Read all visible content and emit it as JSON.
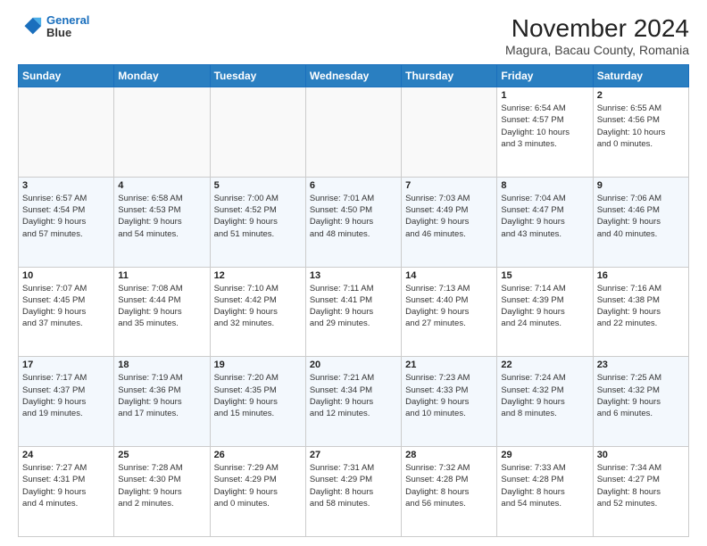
{
  "logo": {
    "line1": "General",
    "line2": "Blue"
  },
  "title": "November 2024",
  "location": "Magura, Bacau County, Romania",
  "days_of_week": [
    "Sunday",
    "Monday",
    "Tuesday",
    "Wednesday",
    "Thursday",
    "Friday",
    "Saturday"
  ],
  "weeks": [
    [
      {
        "day": "",
        "info": ""
      },
      {
        "day": "",
        "info": ""
      },
      {
        "day": "",
        "info": ""
      },
      {
        "day": "",
        "info": ""
      },
      {
        "day": "",
        "info": ""
      },
      {
        "day": "1",
        "info": "Sunrise: 6:54 AM\nSunset: 4:57 PM\nDaylight: 10 hours\nand 3 minutes."
      },
      {
        "day": "2",
        "info": "Sunrise: 6:55 AM\nSunset: 4:56 PM\nDaylight: 10 hours\nand 0 minutes."
      }
    ],
    [
      {
        "day": "3",
        "info": "Sunrise: 6:57 AM\nSunset: 4:54 PM\nDaylight: 9 hours\nand 57 minutes."
      },
      {
        "day": "4",
        "info": "Sunrise: 6:58 AM\nSunset: 4:53 PM\nDaylight: 9 hours\nand 54 minutes."
      },
      {
        "day": "5",
        "info": "Sunrise: 7:00 AM\nSunset: 4:52 PM\nDaylight: 9 hours\nand 51 minutes."
      },
      {
        "day": "6",
        "info": "Sunrise: 7:01 AM\nSunset: 4:50 PM\nDaylight: 9 hours\nand 48 minutes."
      },
      {
        "day": "7",
        "info": "Sunrise: 7:03 AM\nSunset: 4:49 PM\nDaylight: 9 hours\nand 46 minutes."
      },
      {
        "day": "8",
        "info": "Sunrise: 7:04 AM\nSunset: 4:47 PM\nDaylight: 9 hours\nand 43 minutes."
      },
      {
        "day": "9",
        "info": "Sunrise: 7:06 AM\nSunset: 4:46 PM\nDaylight: 9 hours\nand 40 minutes."
      }
    ],
    [
      {
        "day": "10",
        "info": "Sunrise: 7:07 AM\nSunset: 4:45 PM\nDaylight: 9 hours\nand 37 minutes."
      },
      {
        "day": "11",
        "info": "Sunrise: 7:08 AM\nSunset: 4:44 PM\nDaylight: 9 hours\nand 35 minutes."
      },
      {
        "day": "12",
        "info": "Sunrise: 7:10 AM\nSunset: 4:42 PM\nDaylight: 9 hours\nand 32 minutes."
      },
      {
        "day": "13",
        "info": "Sunrise: 7:11 AM\nSunset: 4:41 PM\nDaylight: 9 hours\nand 29 minutes."
      },
      {
        "day": "14",
        "info": "Sunrise: 7:13 AM\nSunset: 4:40 PM\nDaylight: 9 hours\nand 27 minutes."
      },
      {
        "day": "15",
        "info": "Sunrise: 7:14 AM\nSunset: 4:39 PM\nDaylight: 9 hours\nand 24 minutes."
      },
      {
        "day": "16",
        "info": "Sunrise: 7:16 AM\nSunset: 4:38 PM\nDaylight: 9 hours\nand 22 minutes."
      }
    ],
    [
      {
        "day": "17",
        "info": "Sunrise: 7:17 AM\nSunset: 4:37 PM\nDaylight: 9 hours\nand 19 minutes."
      },
      {
        "day": "18",
        "info": "Sunrise: 7:19 AM\nSunset: 4:36 PM\nDaylight: 9 hours\nand 17 minutes."
      },
      {
        "day": "19",
        "info": "Sunrise: 7:20 AM\nSunset: 4:35 PM\nDaylight: 9 hours\nand 15 minutes."
      },
      {
        "day": "20",
        "info": "Sunrise: 7:21 AM\nSunset: 4:34 PM\nDaylight: 9 hours\nand 12 minutes."
      },
      {
        "day": "21",
        "info": "Sunrise: 7:23 AM\nSunset: 4:33 PM\nDaylight: 9 hours\nand 10 minutes."
      },
      {
        "day": "22",
        "info": "Sunrise: 7:24 AM\nSunset: 4:32 PM\nDaylight: 9 hours\nand 8 minutes."
      },
      {
        "day": "23",
        "info": "Sunrise: 7:25 AM\nSunset: 4:32 PM\nDaylight: 9 hours\nand 6 minutes."
      }
    ],
    [
      {
        "day": "24",
        "info": "Sunrise: 7:27 AM\nSunset: 4:31 PM\nDaylight: 9 hours\nand 4 minutes."
      },
      {
        "day": "25",
        "info": "Sunrise: 7:28 AM\nSunset: 4:30 PM\nDaylight: 9 hours\nand 2 minutes."
      },
      {
        "day": "26",
        "info": "Sunrise: 7:29 AM\nSunset: 4:29 PM\nDaylight: 9 hours\nand 0 minutes."
      },
      {
        "day": "27",
        "info": "Sunrise: 7:31 AM\nSunset: 4:29 PM\nDaylight: 8 hours\nand 58 minutes."
      },
      {
        "day": "28",
        "info": "Sunrise: 7:32 AM\nSunset: 4:28 PM\nDaylight: 8 hours\nand 56 minutes."
      },
      {
        "day": "29",
        "info": "Sunrise: 7:33 AM\nSunset: 4:28 PM\nDaylight: 8 hours\nand 54 minutes."
      },
      {
        "day": "30",
        "info": "Sunrise: 7:34 AM\nSunset: 4:27 PM\nDaylight: 8 hours\nand 52 minutes."
      }
    ]
  ]
}
